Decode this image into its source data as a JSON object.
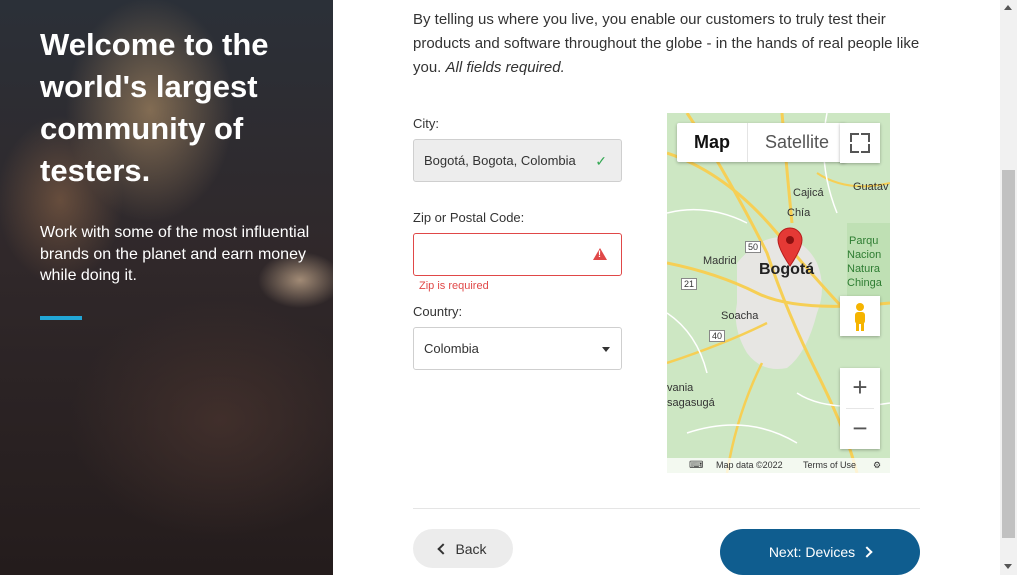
{
  "hero": {
    "title": "Welcome to the world's largest community of testers.",
    "subtitle": "Work with some of the most influential brands on the planet and earn money while doing it.",
    "accent_color": "#22a6d6"
  },
  "intro": {
    "text": "By telling us where you live, you enable our customers to truly test their products and software throughout the globe - in the hands of real people like you.",
    "required_note": "All fields required."
  },
  "form": {
    "city": {
      "label": "City:",
      "value": "Bogotá, Bogota, Colombia",
      "status_icon": "check-icon"
    },
    "zip": {
      "label": "Zip or Postal Code:",
      "value": "",
      "error": "Zip is required",
      "status_icon": "warning-icon"
    },
    "country": {
      "label": "Country:",
      "selected": "Colombia"
    }
  },
  "map": {
    "tabs": {
      "map": "Map",
      "satellite": "Satellite"
    },
    "places": {
      "cajica": "Cajicá",
      "chia": "Chía",
      "guatavita": "Guatav",
      "madrid": "Madrid",
      "bogota": "Bogotá",
      "soacha": "Soacha",
      "parque": "Parqu",
      "nacional": "Nacion",
      "natural": "Natura",
      "chingaza": "Chinga",
      "vania": "vania",
      "sagasuga": "sagasugá"
    },
    "route_shields": [
      "50",
      "21",
      "40"
    ],
    "zoom_in": "+",
    "zoom_out": "−",
    "attribution": {
      "data": "Map data ©2022",
      "terms": "Terms of Use"
    },
    "marker_color": "#e53935"
  },
  "actions": {
    "back": "Back",
    "next": "Next: Devices",
    "next_color": "#0f5d8f"
  }
}
